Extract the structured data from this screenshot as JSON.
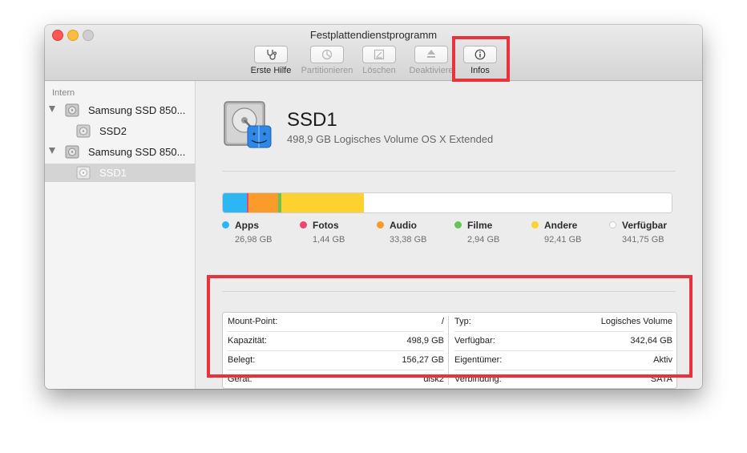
{
  "window": {
    "title": "Festplattendienstprogramm"
  },
  "toolbar": {
    "items": [
      {
        "label": "Erste Hilfe",
        "icon": "stethoscope-icon",
        "enabled": true
      },
      {
        "label": "Partitionieren",
        "icon": "pie-chart-icon",
        "enabled": false
      },
      {
        "label": "Löschen",
        "icon": "erase-icon",
        "enabled": false
      },
      {
        "label": "Deaktiviere",
        "icon": "unmount-icon",
        "enabled": false
      },
      {
        "label": "Infos",
        "icon": "info-icon",
        "enabled": true
      }
    ]
  },
  "sidebar": {
    "section": "Intern",
    "items": [
      {
        "label": "Samsung SSD 850...",
        "type": "disk",
        "expanded": true
      },
      {
        "label": "SSD2",
        "type": "volume",
        "selected": false
      },
      {
        "label": "Samsung SSD 850...",
        "type": "disk",
        "expanded": true
      },
      {
        "label": "SSD1",
        "type": "volume",
        "selected": true
      }
    ]
  },
  "volume": {
    "name": "SSD1",
    "subtitle": "498,9 GB Logisches Volume OS X Extended"
  },
  "usage": {
    "categories": [
      {
        "name": "Apps",
        "size": "26,98 GB",
        "gb": 26.98,
        "color": "#2db6f4"
      },
      {
        "name": "Fotos",
        "size": "1,44 GB",
        "gb": 1.44,
        "color": "#f0446f"
      },
      {
        "name": "Audio",
        "size": "33,38 GB",
        "gb": 33.38,
        "color": "#fb9b2a"
      },
      {
        "name": "Filme",
        "size": "2,94 GB",
        "gb": 2.94,
        "color": "#62c554"
      },
      {
        "name": "Andere",
        "size": "92,41 GB",
        "gb": 92.41,
        "color": "#fdd12f"
      },
      {
        "name": "Verfügbar",
        "size": "341,75 GB",
        "gb": 341.75,
        "color": "#ffffff"
      }
    ]
  },
  "info": {
    "left": [
      {
        "key": "Mount-Point:",
        "value": "/"
      },
      {
        "key": "Kapazität:",
        "value": "498,9 GB"
      },
      {
        "key": "Belegt:",
        "value": "156,27 GB"
      },
      {
        "key": "Gerät:",
        "value": "disk2"
      }
    ],
    "right": [
      {
        "key": "Typ:",
        "value": "Logisches Volume"
      },
      {
        "key": "Verfügbar:",
        "value": "342,64 GB"
      },
      {
        "key": "Eigentümer:",
        "value": "Aktiv"
      },
      {
        "key": "Verbindung:",
        "value": "SATA"
      }
    ]
  },
  "colors": {
    "highlight": "#e8333c",
    "selection": "#d4d4d4"
  }
}
